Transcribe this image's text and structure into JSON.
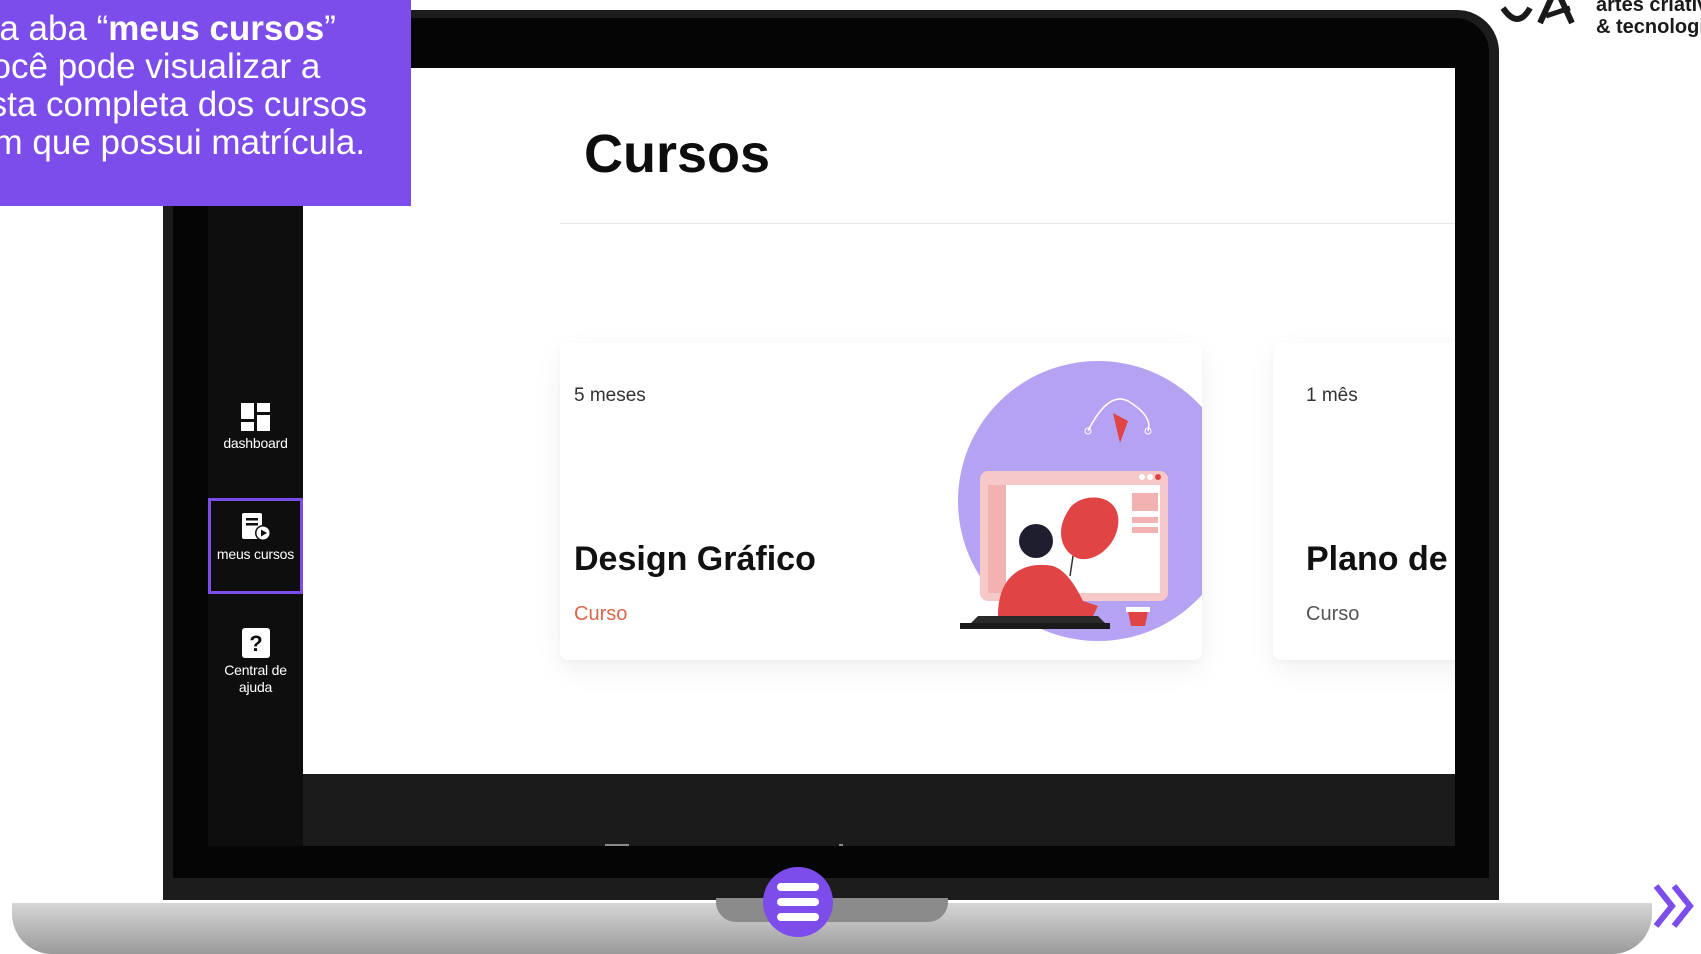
{
  "callout": {
    "line1_prefix": "Na aba “",
    "line1_bold": "meus cursos",
    "line1_suffix": "”",
    "line2": "você pode visualizar a",
    "line3": "lista completa dos cursos",
    "line4": "em que possui matrícula."
  },
  "brand": {
    "line1": "artes criativas",
    "line2": "& tecnologia"
  },
  "sidebar": {
    "items": [
      {
        "label": "dashboard",
        "icon": "dashboard-icon",
        "active": false
      },
      {
        "label": "meus cursos",
        "icon": "course-video-icon",
        "active": true
      },
      {
        "label_line1": "Central de",
        "label_line2": "ajuda",
        "icon": "help-icon",
        "active": false
      }
    ]
  },
  "page": {
    "title": "Cursos"
  },
  "courses": [
    {
      "duration": "5 meses",
      "title": "Design Gráfico",
      "type": "Curso",
      "type_color": "#d9674a",
      "illustration": "designer-at-monitor-illustration"
    },
    {
      "duration": "1 mês",
      "title": "Plano de",
      "type": "Curso",
      "type_color": "#555555"
    }
  ],
  "colors": {
    "accent": "#7c4dea",
    "illustration_circle": "#b6a2f3",
    "illustration_red": "#e04444"
  },
  "controls": {
    "menu_icon": "hamburger-menu-icon",
    "next_icon": "double-chevron-right-icon"
  }
}
